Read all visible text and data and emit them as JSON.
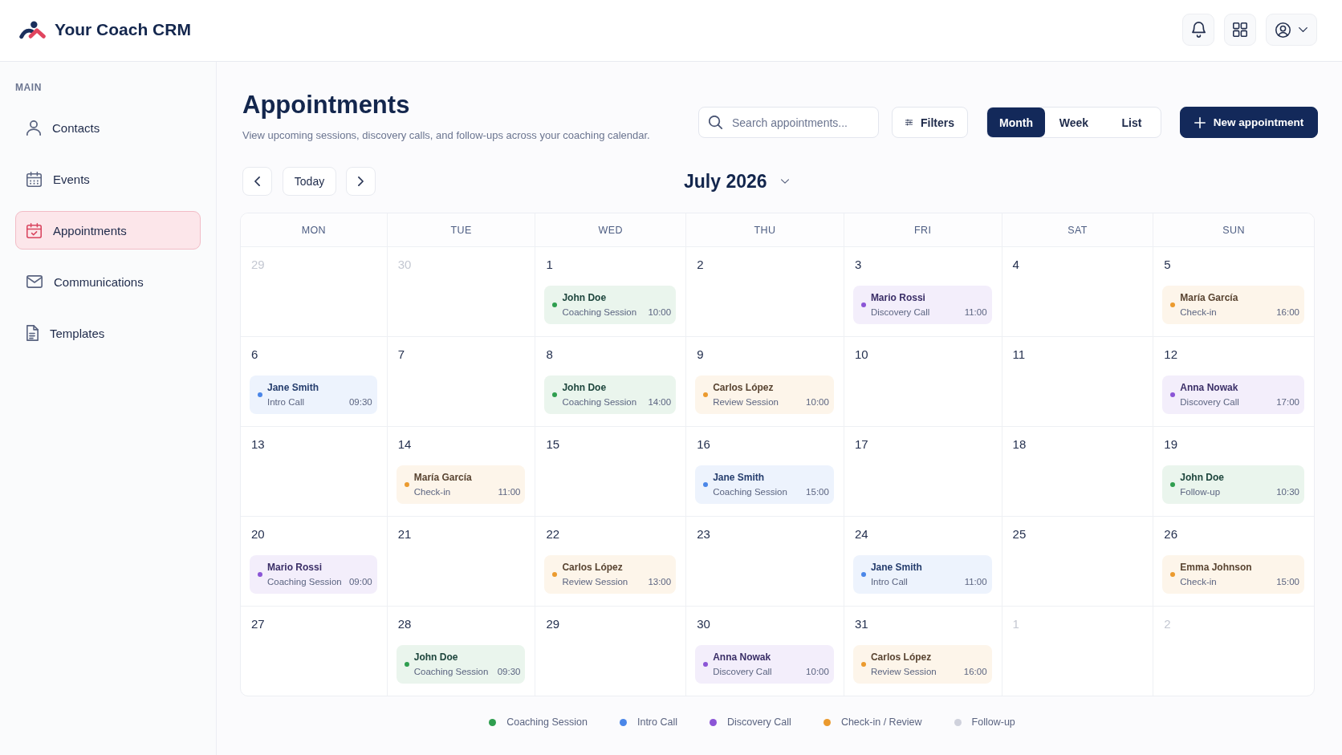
{
  "app": {
    "title": "Your Coach CRM"
  },
  "sidebar": {
    "section_label": "MAIN",
    "items": [
      {
        "label": "Contacts",
        "selected": false
      },
      {
        "label": "Events",
        "selected": false
      },
      {
        "label": "Appointments",
        "selected": true
      },
      {
        "label": "Communications",
        "selected": false
      },
      {
        "label": "Templates",
        "selected": false
      }
    ]
  },
  "page": {
    "title": "Appointments",
    "subtitle": "View upcoming sessions, discovery calls, and follow-ups across your coaching calendar."
  },
  "toolbar": {
    "search": {
      "placeholder": "Search appointments..."
    },
    "filters_button": "Filters",
    "views": [
      {
        "label": "Month",
        "selected": true
      },
      {
        "label": "Week",
        "selected": false
      },
      {
        "label": "List",
        "selected": false
      }
    ],
    "new_button": "New appointment"
  },
  "calendar": {
    "today_button": "Today",
    "month_title": "July 2026",
    "weekdays": [
      "MON",
      "TUE",
      "WED",
      "THU",
      "FRI",
      "SAT",
      "SUN"
    ],
    "weeks": [
      {
        "days": [
          {
            "day": "29",
            "muted": true
          },
          {
            "day": "30",
            "muted": true
          },
          {
            "day": "1",
            "muted": false,
            "events": [
              {
                "name": "John Doe",
                "type": "Coaching Session",
                "time": "10:00",
                "color": "#2f9e4f"
              }
            ]
          },
          {
            "day": "2",
            "muted": false
          },
          {
            "day": "3",
            "muted": false,
            "events": [
              {
                "name": "Mario Rossi",
                "type": "Discovery Call",
                "time": "11:00",
                "color": "#8b55d6"
              }
            ]
          },
          {
            "day": "4",
            "muted": false
          },
          {
            "day": "5",
            "muted": false,
            "events": [
              {
                "name": "María García",
                "type": "Check-in",
                "time": "16:00",
                "color": "#eb9a2e"
              }
            ]
          }
        ]
      },
      {
        "days": [
          {
            "day": "6",
            "muted": false,
            "events": [
              {
                "name": "Jane Smith",
                "type": "Intro Call",
                "time": "09:30",
                "color": "#4a86e8"
              }
            ]
          },
          {
            "day": "7",
            "muted": false
          },
          {
            "day": "8",
            "muted": false,
            "events": [
              {
                "name": "John Doe",
                "type": "Coaching Session",
                "time": "14:00",
                "color": "#2f9e4f"
              }
            ]
          },
          {
            "day": "9",
            "muted": false,
            "events": [
              {
                "name": "Carlos López",
                "type": "Review Session",
                "time": "10:00",
                "color": "#eb9a2e"
              }
            ]
          },
          {
            "day": "10",
            "muted": false
          },
          {
            "day": "11",
            "muted": false
          },
          {
            "day": "12",
            "muted": false,
            "events": [
              {
                "name": "Anna Nowak",
                "type": "Discovery Call",
                "time": "17:00",
                "color": "#8b55d6"
              }
            ]
          }
        ]
      },
      {
        "days": [
          {
            "day": "13",
            "muted": false
          },
          {
            "day": "14",
            "muted": false,
            "events": [
              {
                "name": "María García",
                "type": "Check-in",
                "time": "11:00",
                "color": "#eb9a2e"
              }
            ]
          },
          {
            "day": "15",
            "muted": false
          },
          {
            "day": "16",
            "muted": false,
            "events": [
              {
                "name": "Jane Smith",
                "type": "Coaching Session",
                "time": "15:00",
                "color": "#4a86e8"
              }
            ]
          },
          {
            "day": "17",
            "muted": false
          },
          {
            "day": "18",
            "muted": false
          },
          {
            "day": "19",
            "muted": false,
            "events": [
              {
                "name": "John Doe",
                "type": "Follow-up",
                "time": "10:30",
                "color": "#2f9e4f"
              }
            ]
          }
        ]
      },
      {
        "days": [
          {
            "day": "20",
            "muted": false,
            "events": [
              {
                "name": "Mario Rossi",
                "type": "Coaching Session",
                "time": "09:00",
                "color": "#8b55d6"
              }
            ]
          },
          {
            "day": "21",
            "muted": false
          },
          {
            "day": "22",
            "muted": false,
            "events": [
              {
                "name": "Carlos López",
                "type": "Review Session",
                "time": "13:00",
                "color": "#eb9a2e"
              }
            ]
          },
          {
            "day": "23",
            "muted": false
          },
          {
            "day": "24",
            "muted": false,
            "events": [
              {
                "name": "Jane Smith",
                "type": "Intro Call",
                "time": "11:00",
                "color": "#4a86e8"
              }
            ]
          },
          {
            "day": "25",
            "muted": false
          },
          {
            "day": "26",
            "muted": false,
            "events": [
              {
                "name": "Emma Johnson",
                "type": "Check-in",
                "time": "15:00",
                "color": "#eb9a2e"
              }
            ]
          }
        ]
      },
      {
        "days": [
          {
            "day": "27",
            "muted": false
          },
          {
            "day": "28",
            "muted": false,
            "events": [
              {
                "name": "John Doe",
                "type": "Coaching Session",
                "time": "09:30",
                "color": "#2f9e4f"
              }
            ]
          },
          {
            "day": "29",
            "muted": false
          },
          {
            "day": "30",
            "muted": false,
            "events": [
              {
                "name": "Anna Nowak",
                "type": "Discovery Call",
                "time": "10:00",
                "color": "#8b55d6"
              }
            ]
          },
          {
            "day": "31",
            "muted": false,
            "events": [
              {
                "name": "Carlos López",
                "type": "Review Session",
                "time": "16:00",
                "color": "#eb9a2e"
              }
            ]
          },
          {
            "day": "1",
            "muted": true
          },
          {
            "day": "2",
            "muted": true
          }
        ]
      }
    ]
  },
  "legend": [
    {
      "label": "Coaching Session",
      "color": "#2f9e4f"
    },
    {
      "label": "Intro Call",
      "color": "#4a86e8"
    },
    {
      "label": "Discovery Call",
      "color": "#8b55d6"
    },
    {
      "label": "Check-in / Review",
      "color": "#eb9a2e"
    },
    {
      "label": "Follow-up",
      "color": "#cfd1dc"
    }
  ]
}
